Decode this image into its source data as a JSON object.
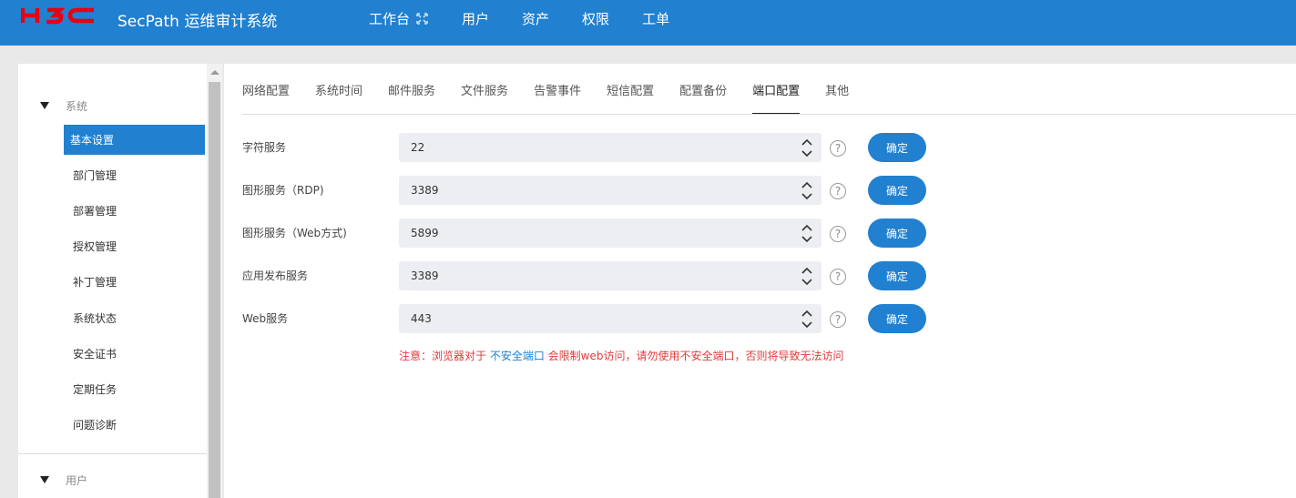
{
  "header": {
    "logo_text": "H3C",
    "app_title": "SecPath 运维审计系统",
    "nav": [
      {
        "label": "工作台"
      },
      {
        "label": "用户"
      },
      {
        "label": "资产"
      },
      {
        "label": "权限"
      },
      {
        "label": "工单"
      }
    ]
  },
  "sidebar": {
    "groups": [
      {
        "label": "系统"
      },
      {
        "label": "用户"
      }
    ],
    "items": [
      {
        "label": "基本设置"
      },
      {
        "label": "部门管理"
      },
      {
        "label": "部署管理"
      },
      {
        "label": "授权管理"
      },
      {
        "label": "补丁管理"
      },
      {
        "label": "系统状态"
      },
      {
        "label": "安全证书"
      },
      {
        "label": "定期任务"
      },
      {
        "label": "问题诊断"
      }
    ]
  },
  "tabs": [
    {
      "label": "网络配置"
    },
    {
      "label": "系统时间"
    },
    {
      "label": "邮件服务"
    },
    {
      "label": "文件服务"
    },
    {
      "label": "告警事件"
    },
    {
      "label": "短信配置"
    },
    {
      "label": "配置备份"
    },
    {
      "label": "端口配置"
    },
    {
      "label": "其他"
    }
  ],
  "ports": [
    {
      "label": "字符服务",
      "value": "22"
    },
    {
      "label": "图形服务（RDP)",
      "value": "3389"
    },
    {
      "label": "图形服务（Web方式)",
      "value": "5899"
    },
    {
      "label": "应用发布服务",
      "value": "3389"
    },
    {
      "label": "Web服务",
      "value": "443"
    }
  ],
  "confirm_label": "确定",
  "help_symbol": "?",
  "notice": {
    "prefix": "注意：浏览器对于 ",
    "link": "不安全端口",
    "suffix": " 会限制web访问，请勿使用不安全端口，否则将导致无法访问"
  },
  "colors": {
    "primary": "#2180d0",
    "notice": "#e23a3a"
  }
}
